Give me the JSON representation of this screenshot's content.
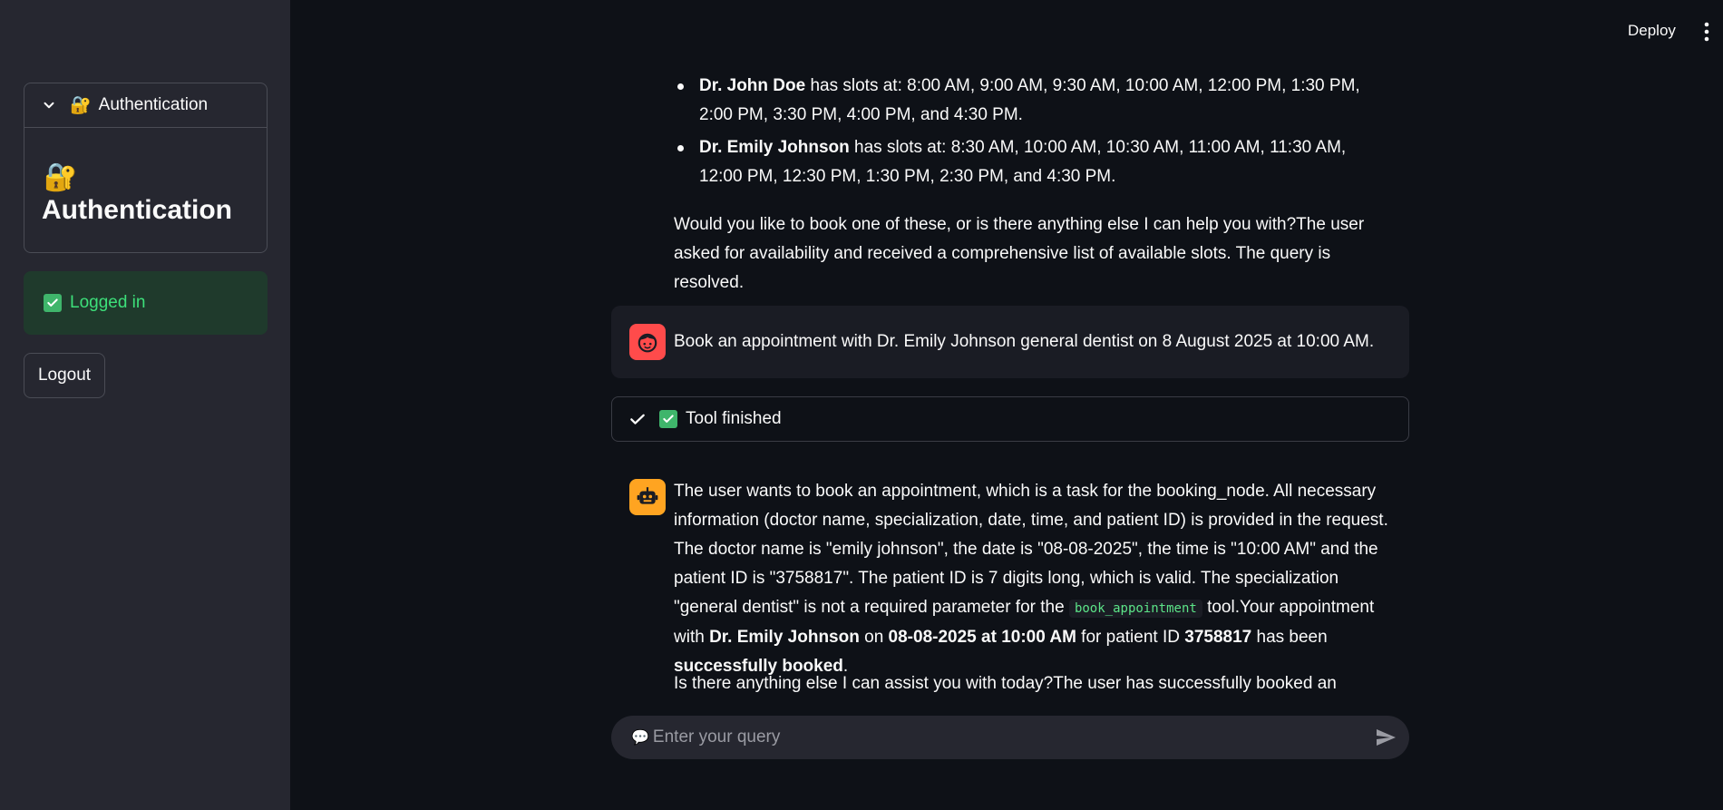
{
  "sidebar": {
    "expander": {
      "title": "Authentication",
      "lock_emoji": "🔐",
      "body_title": "Authentication"
    },
    "status_text": "Logged in",
    "logout_label": "Logout"
  },
  "header": {
    "deploy_label": "Deploy"
  },
  "chat": {
    "slots": [
      {
        "doctor": "Dr. John Doe",
        "text": " has slots at: 8:00 AM, 9:00 AM, 9:30 AM, 10:00 AM, 12:00 PM, 1:30 PM, 2:00 PM, 3:30 PM, 4:00 PM, and 4:30 PM."
      },
      {
        "doctor": "Dr. Emily Johnson",
        "text": " has slots at: 8:30 AM, 10:00 AM, 10:30 AM, 11:00 AM, 11:30 AM, 12:00 PM, 12:30 PM, 1:30 PM, 2:30 PM, and 4:30 PM."
      }
    ],
    "assistant_paragraph_1": "Would you like to book one of these, or is there anything else I can help you with?The user asked for availability and received a comprehensive list of available slots. The query is resolved.",
    "user_message": "Book an appointment with Dr. Emily Johnson general dentist on 8 August 2025 at 10:00 AM.",
    "tool_status": "Tool finished",
    "bot_message": {
      "part1": "The user wants to book an appointment, which is a task for the booking_node. All necessary information (doctor name, specialization, date, time, and patient ID) is provided in the request. The doctor name is \"emily johnson\", the date is \"08-08-2025\", the time is \"10:00 AM\" and the patient ID is \"3758817\". The patient ID is 7 digits long, which is valid. The specialization \"general dentist\" is not a required parameter for the ",
      "code": "book_appointment",
      "part2": " tool.Your appointment with ",
      "doctor": "Dr. Emily Johnson",
      "part3": " on ",
      "datetime": "08-08-2025 at 10:00 AM",
      "part4": " for patient ID ",
      "patient_id": "3758817",
      "part5": " has been ",
      "result": "successfully booked",
      "part6": "."
    },
    "bot_message_2": "Is there anything else I can assist you with today?The user has successfully booked an"
  },
  "input": {
    "placeholder": "Enter your query",
    "icon": "💬"
  }
}
